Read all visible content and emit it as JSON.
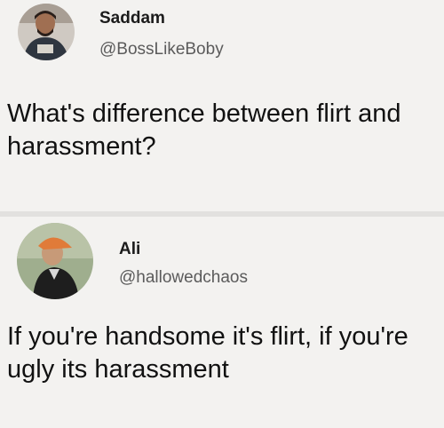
{
  "tweets": [
    {
      "display_name": "Saddam",
      "handle": "@BossLikeBoby",
      "text": "What's difference between flirt and harassment?"
    },
    {
      "display_name": "Ali",
      "handle": "@hallowedchaos",
      "text": "If you're handsome it's flirt, if you're ugly its harassment"
    }
  ],
  "colors": {
    "background": "#f3f2f0",
    "text": "#111111",
    "handle": "#5b5b5b"
  }
}
